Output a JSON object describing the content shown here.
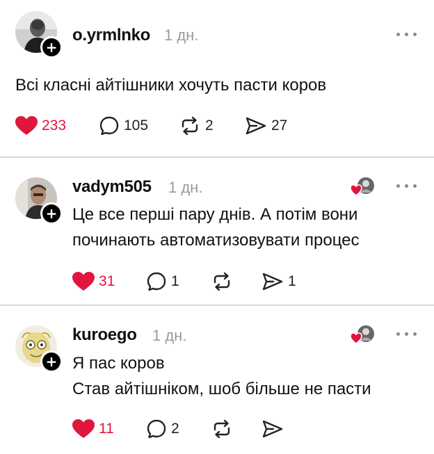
{
  "posts": [
    {
      "username": "o.yrmlnko",
      "time": "1 дн.",
      "lines": [
        "Всі класні айтішники хочуть пасти коров"
      ],
      "likes": "233",
      "replies": "105",
      "reposts": "2",
      "shares": "27"
    },
    {
      "username": "vadym505",
      "time": "1 дн.",
      "lines": [
        "Це все перші пару днів. А потім вони",
        "починають автоматизовувати процес"
      ],
      "likes": "31",
      "replies": "1",
      "reposts": "",
      "shares": "1"
    },
    {
      "username": "kuroego",
      "time": "1 дн.",
      "lines": [
        "Я пас коров",
        "Став айтішніком, шоб більше не пасти"
      ],
      "likes": "11",
      "replies": "2",
      "reposts": "",
      "shares": ""
    }
  ],
  "icons": {
    "like": "heart-icon",
    "reply": "speech-bubble-icon",
    "repost": "repost-arrows-icon",
    "share": "send-icon",
    "more": "more-horizontal-icon",
    "follow": "plus-icon"
  },
  "colors": {
    "like_active": "#e0163c",
    "muted": "#9a9a9a",
    "divider": "#d9d9d9"
  }
}
